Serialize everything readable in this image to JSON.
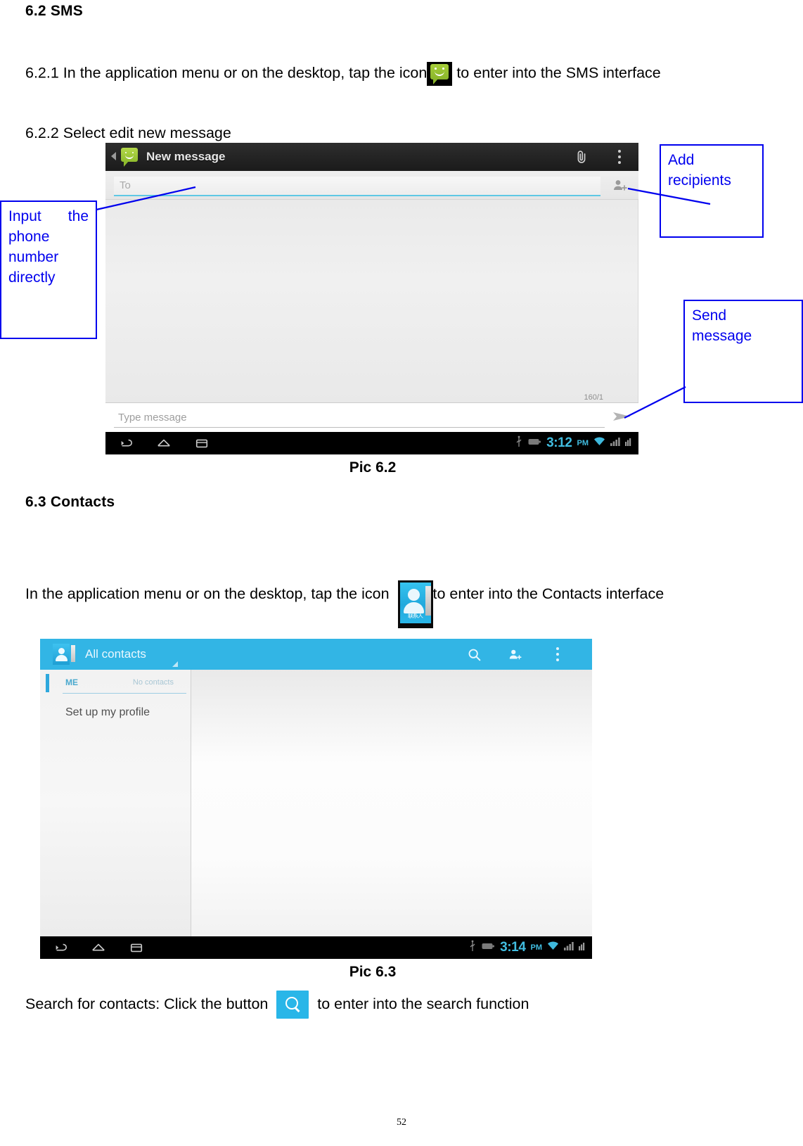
{
  "document": {
    "section_sms": {
      "heading": "6.2 SMS",
      "para_621_before": "6.2.1 In the application menu or on the desktop, tap the icon",
      "para_621_after": "to enter into the SMS interface",
      "para_622": "6.2.2 Select edit new message",
      "caption_62": "Pic 6.2"
    },
    "section_contacts": {
      "heading": "6.3 Contacts",
      "para_before": "In the application menu or on the desktop, tap the icon",
      "para_after": "to enter into the Contacts interface",
      "caption_63": "Pic 6.3",
      "search_before": "Search for contacts: Click the button",
      "search_after": "to enter into the search function"
    },
    "page_number": "52"
  },
  "annotations": {
    "input_phone": {
      "line1": "Input the",
      "line2": "phone",
      "line3": "number",
      "line4": "directly"
    },
    "add_recipients": {
      "line1": "Add",
      "line2": "recipients"
    },
    "send_message": {
      "line1": "Send",
      "line2": "message"
    },
    "accent_color": "#0000ee"
  },
  "sms_screen": {
    "titlebar": {
      "title": "New message",
      "app_icon": "sms-bubble-icon",
      "back_icon": "back-chevron-icon",
      "attach_icon": "paperclip-icon",
      "overflow_icon": "overflow-menu-icon"
    },
    "to_field": {
      "placeholder": "To",
      "value": "",
      "add_recipient_icon": "add-contact-icon"
    },
    "compose": {
      "placeholder": "Type message",
      "value": "",
      "char_counter": "160/1",
      "send_icon": "send-arrow-icon"
    },
    "navbar": {
      "back_icon": "nav-back-icon",
      "home_icon": "nav-home-icon",
      "recents_icon": "nav-recents-icon",
      "usb_icon": "usb-icon",
      "battery_icon": "battery-icon",
      "time": "3:12",
      "ampm": "PM",
      "wifi_icon": "wifi-icon",
      "signal_icon": "signal-bars-icon"
    },
    "accent_color": "#5ec8e4"
  },
  "contacts_screen": {
    "titlebar": {
      "title": "All contacts",
      "app_icon": "contacts-app-icon",
      "dropdown_icon": "dropdown-caret-icon",
      "search_icon": "search-icon",
      "add_contact_icon": "add-contact-icon",
      "overflow_icon": "overflow-menu-icon",
      "background_color": "#32b5e5"
    },
    "list": {
      "group_label": "ME",
      "group_count": "No contacts",
      "item_profile": "Set up my profile"
    },
    "navbar": {
      "back_icon": "nav-back-icon",
      "home_icon": "nav-home-icon",
      "recents_icon": "nav-recents-icon",
      "usb_icon": "usb-icon",
      "battery_icon": "battery-icon",
      "time": "3:14",
      "ampm": "PM",
      "wifi_icon": "wifi-icon",
      "signal_icon": "signal-bars-icon"
    }
  }
}
